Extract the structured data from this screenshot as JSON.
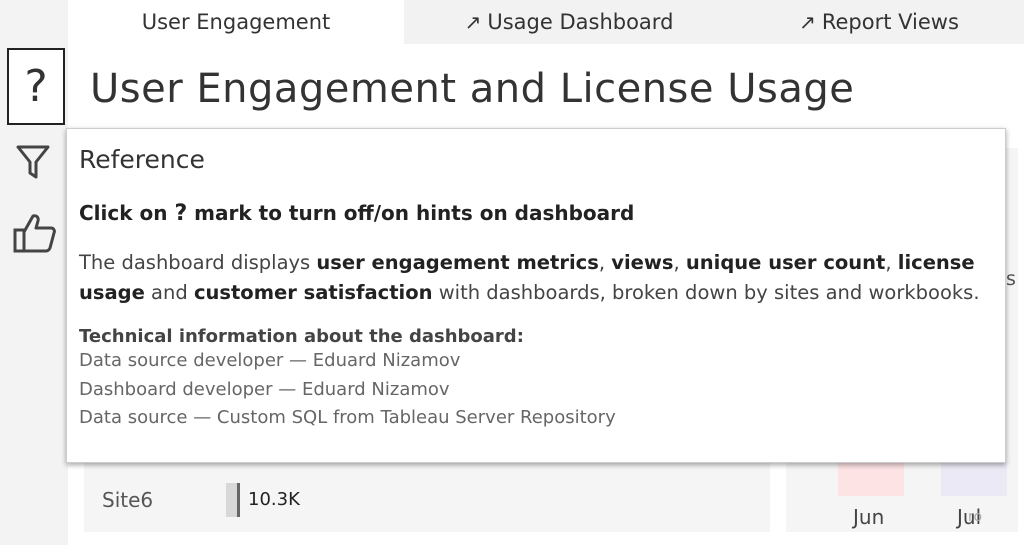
{
  "tabs": [
    {
      "label": "User Engagement",
      "active": true,
      "icon": ""
    },
    {
      "label": "Usage Dashboard",
      "active": false,
      "icon": "↗"
    },
    {
      "label": "Report Views",
      "active": false,
      "icon": "↗"
    }
  ],
  "sidebar": {
    "help_label": "?",
    "icons": [
      "question-mark-icon",
      "filter-icon",
      "thumbs-up-icon"
    ]
  },
  "page_title": "User Engagement and License Usage",
  "tooltip": {
    "heading": "Reference",
    "hint_before": "Click on ",
    "hint_mark": "?",
    "hint_after": " mark to turn off/on hints on dashboard",
    "desc": [
      {
        "text": "The dashboard displays ",
        "bold": false
      },
      {
        "text": "user engagement metrics",
        "bold": true
      },
      {
        "text": ", ",
        "bold": false
      },
      {
        "text": "views",
        "bold": true
      },
      {
        "text": ", ",
        "bold": false
      },
      {
        "text": "unique user count",
        "bold": true
      },
      {
        "text": ", ",
        "bold": false
      },
      {
        "text": "license usage",
        "bold": true
      },
      {
        "text": " and ",
        "bold": false
      },
      {
        "text": "customer satisfaction",
        "bold": true
      },
      {
        "text": " with dashboards, broken down by sites and workbooks.",
        "bold": false
      }
    ],
    "tech_title": "Technical information about the dashboard:",
    "tech_lines": [
      "Data source developer — Eduard Nizamov",
      "Dashboard developer — Eduard Nizamov",
      "Data source — Custom SQL from Tableau Server Repository"
    ]
  },
  "background": {
    "site_label": "Site6",
    "site_value": "10.3K",
    "right_edge_text": "s",
    "months": [
      "Jun",
      "Jul"
    ],
    "watermark": "ro"
  },
  "colors": {
    "tab_inactive_bg": "#f2f2f2",
    "rail_bg": "#f3f3f3",
    "bar_pink": "#fde3e3",
    "bar_lilac": "#ebe9f5"
  }
}
